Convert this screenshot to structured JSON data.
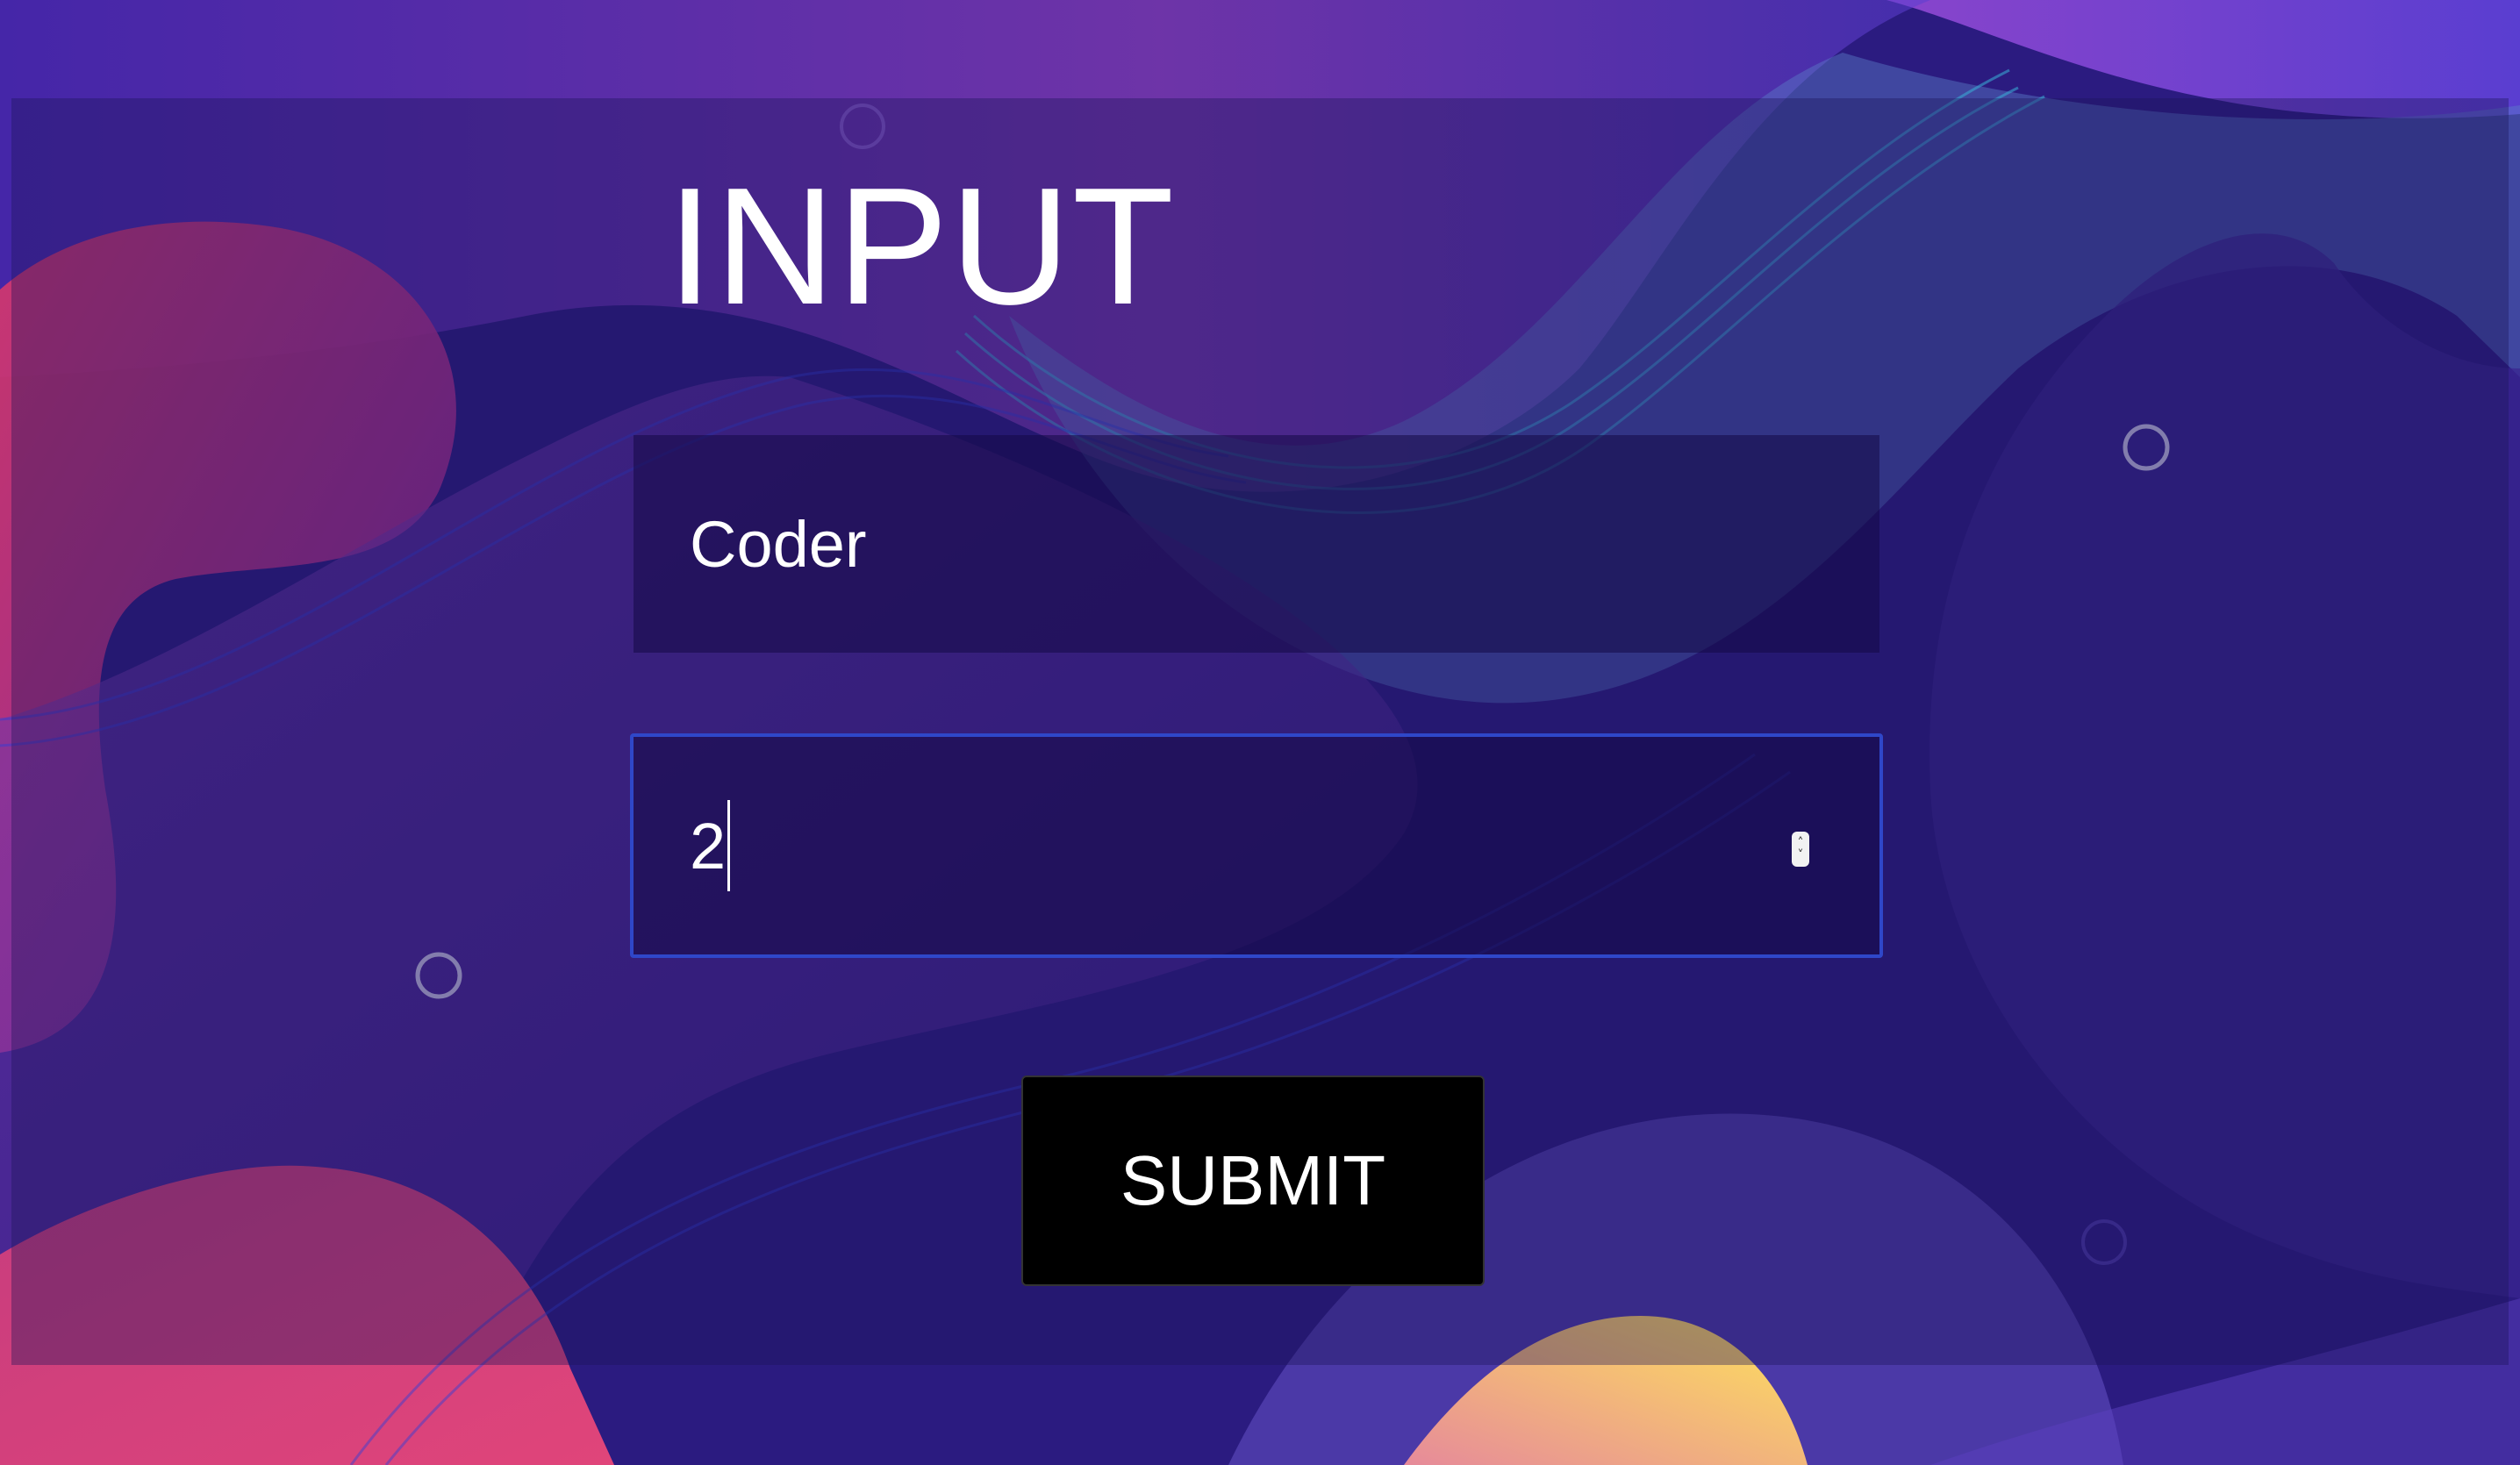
{
  "form": {
    "title": "INPUT",
    "name_field": {
      "value": "Coder"
    },
    "number_field": {
      "value": "2"
    },
    "submit_label": "SUBMIT"
  },
  "icons": {
    "stepper": "spinner-arrows-icon"
  },
  "colors": {
    "background": "#2a1c7a",
    "focus_border": "#2f47c9",
    "button_bg": "#000000",
    "text": "#ffffff"
  }
}
